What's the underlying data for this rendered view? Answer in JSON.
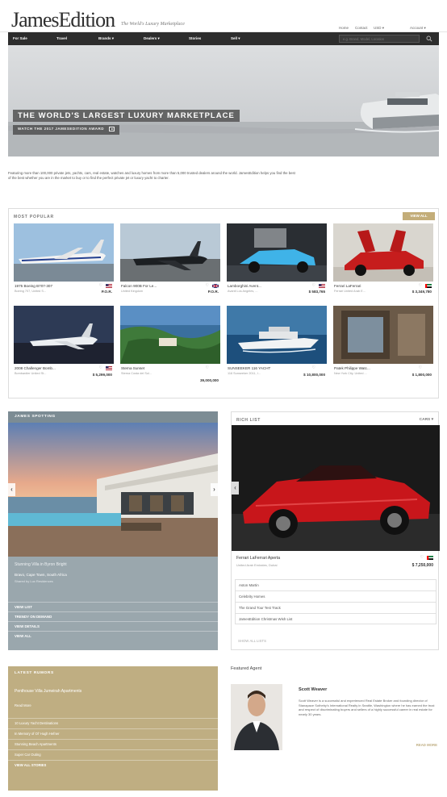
{
  "header": {
    "logo": "JamesEdition",
    "tagline": "The World's Luxury Marketplace",
    "utility": [
      "Home",
      "Contact",
      "USD ▾",
      "Account ▾"
    ]
  },
  "nav": {
    "items": [
      "For Sale",
      "Travel",
      "Brands ▾",
      "Dealers ▾",
      "Stories",
      "Sell ▾"
    ],
    "search_placeholder": "e.g. Brand, Model, Location"
  },
  "hero": {
    "title": "THE WORLD'S LARGEST LUXURY MARKETPLACE",
    "button": "WATCH THE 2017 JAMESEDITION AWARD"
  },
  "intro": "Featuring more than 100,000 private jets, yachts, cars, real estate, watches and luxury homes from more than 5,000 trusted dealers around the world. JamesEdition helps you find the best of the best whether you are in the market to buy or to find the perfect private jet or luxury yacht to charter.",
  "popular": {
    "title": "MOST POPULAR",
    "badge": "VIEW ALL",
    "cards": [
      {
        "name": "1975 Boeing B707-307",
        "loc": "Boeing 707, United S...",
        "price": "P.O.R."
      },
      {
        "name": "Falcon 900B For Le...",
        "loc": "United Kingdom",
        "price": "P.O.R."
      },
      {
        "name": "Lamborghini Avent...",
        "loc": "Avanti Los Angeles, ...",
        "price": "$ 583,765"
      },
      {
        "name": "Ferrari LaFerrari",
        "loc": "Ferrari United Arab E...",
        "price": "$ 3,349,780"
      },
      {
        "name": "2008 Challenger Bomb...",
        "loc": "Bombardier United St...",
        "price": "$ 5,299,000"
      },
      {
        "name": "Sterna Sunset",
        "loc": "Sterna Costa del Sol...",
        "price": "39,000,000"
      },
      {
        "name": "SUNSEEKER 116 YACHT",
        "loc": "116 Sunseeker 2011, I...",
        "price": "$ 10,800,000"
      },
      {
        "name": "Patek Philippe Watc...",
        "loc": "New York City, United ...",
        "price": "$ 1,800,000"
      }
    ]
  },
  "spotting": {
    "title": "JAMES SPOTTING",
    "caption": "Stunning Villa in Byron Bright",
    "location": "Bravo, Cape Town, South Africa",
    "by": "Shared by Lux Residences",
    "links": [
      "VIEW LIST",
      "TRENDY ON DEMAND",
      "VIEW DETAILS",
      "VIEW ALL"
    ]
  },
  "rich": {
    "title": "RICH LIST",
    "filter": "CARS ▾",
    "name": "Ferrari LaFerrari Aperta",
    "loc": "United Arab Emirates, Dubai",
    "price": "$ 7,250,000",
    "links": [
      "Aston Martin",
      "Celebrity Homes",
      "The Grand Tour Test Track",
      "JamesEdition Christmas Wish List"
    ],
    "more": "SHOW ALL LISTS"
  },
  "rumors": {
    "title": "LATEST RUMORS",
    "featured": "Penthouse Villa Jumeirah Apartments",
    "read": "Read More",
    "links": [
      "10 Luxury Yacht Destinations",
      "In Memory of Ol' Hugh Hefner",
      "Stunning Beach Apartments",
      "Super Car Outing"
    ],
    "all": "VIEW ALL STORIES"
  },
  "agent": {
    "title": "Featured Agent",
    "name": "Scott Weaver",
    "bio": "Scott Weaver is a successful and experienced Real Estate Broker and founding director of Stanapace Sotheby's International Realty in Seattle, Washington where he has earned the trust and respect of discriminating buyers and sellers of a highly successful career in real estate for nearly 30 years.",
    "more": "READ MORE"
  },
  "colors": {
    "gold": "#bfae82",
    "nav": "#2d2d2d",
    "slate": "#9aa7ad"
  }
}
